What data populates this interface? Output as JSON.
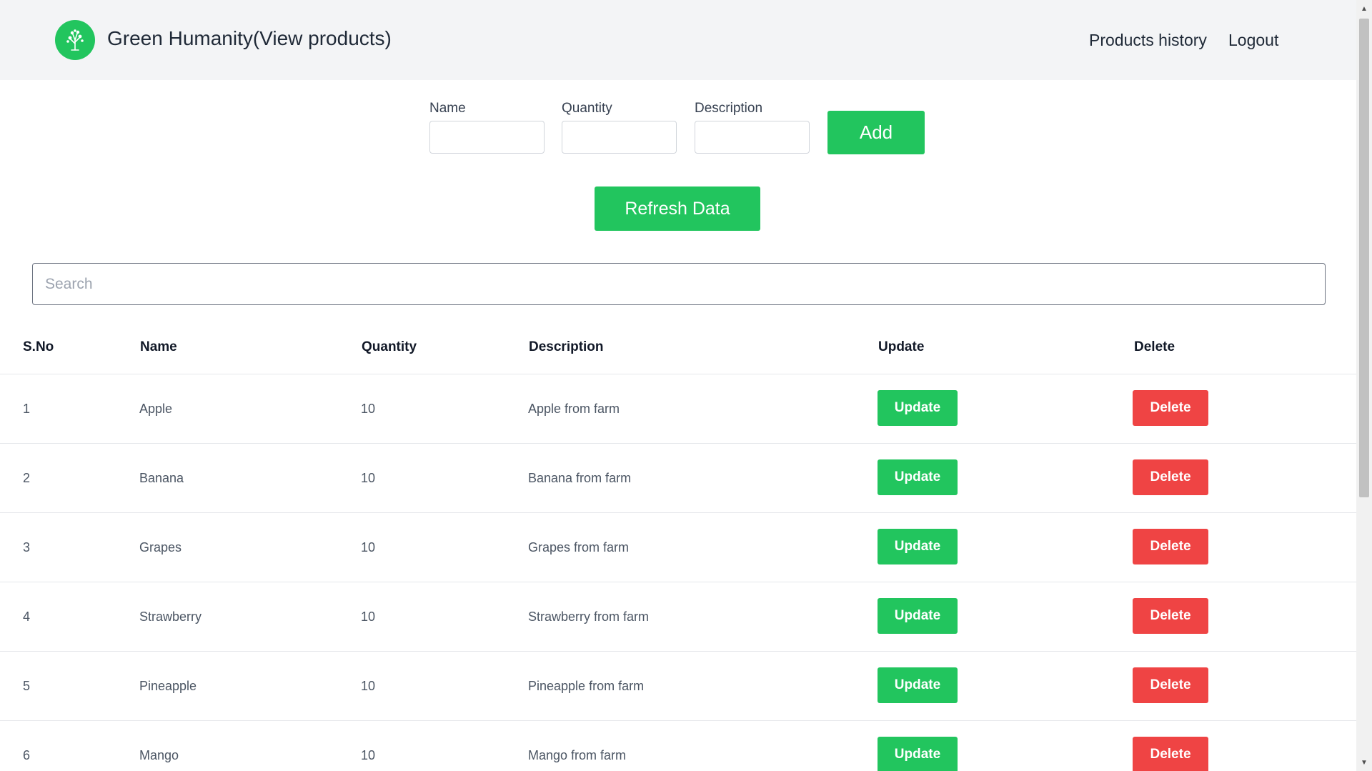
{
  "header": {
    "title": "Green Humanity(View products)",
    "nav": [
      "Products history",
      "Logout"
    ]
  },
  "form": {
    "name_label": "Name",
    "quantity_label": "Quantity",
    "description_label": "Description",
    "name_value": "",
    "quantity_value": "",
    "description_value": "",
    "add_label": "Add",
    "refresh_label": "Refresh Data"
  },
  "search": {
    "placeholder": "Search",
    "value": ""
  },
  "table": {
    "headers": [
      "S.No",
      "Name",
      "Quantity",
      "Description",
      "Update",
      "Delete"
    ],
    "rows": [
      {
        "sno": "1",
        "name": "Apple",
        "quantity": "10",
        "description": "Apple from farm",
        "update": "Update",
        "delete": "Delete"
      },
      {
        "sno": "2",
        "name": "Banana",
        "quantity": "10",
        "description": "Banana from farm",
        "update": "Update",
        "delete": "Delete"
      },
      {
        "sno": "3",
        "name": "Grapes",
        "quantity": "10",
        "description": "Grapes from farm",
        "update": "Update",
        "delete": "Delete"
      },
      {
        "sno": "4",
        "name": "Strawberry",
        "quantity": "10",
        "description": "Strawberry from farm",
        "update": "Update",
        "delete": "Delete"
      },
      {
        "sno": "5",
        "name": "Pineapple",
        "quantity": "10",
        "description": "Pineapple from farm",
        "update": "Update",
        "delete": "Delete"
      },
      {
        "sno": "6",
        "name": "Mango",
        "quantity": "10",
        "description": "Mango from farm",
        "update": "Update",
        "delete": "Delete"
      }
    ]
  },
  "icons": {
    "logo": "tree-icon",
    "scroll_up": "scroll-up-arrow-icon",
    "scroll_down": "scroll-down-arrow-icon"
  },
  "colors": {
    "accent": "#22c55e",
    "danger": "#ef4444",
    "header_bg": "#f3f4f6"
  }
}
